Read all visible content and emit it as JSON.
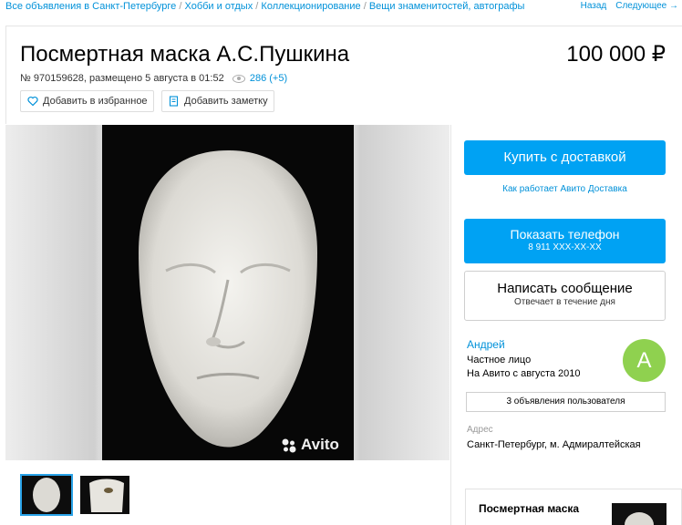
{
  "breadcrumbs": {
    "items": [
      "Все объявления в Санкт-Петербурге",
      "Хобби и отдых",
      "Коллекционирование",
      "Вещи знаменитостей, автографы"
    ],
    "separator": "/"
  },
  "nav": {
    "back": "Назад",
    "next": "Следующее →"
  },
  "listing": {
    "title": "Посмертная маска А.С.Пушкина",
    "price": "100 000 ₽",
    "meta": "№ 970159628, размещено 5 августа в 01:52",
    "views": "286 (+5)"
  },
  "actions": {
    "favorite_label": "Добавить в избранное",
    "note_label": "Добавить заметку"
  },
  "gallery": {
    "watermark": "Avito",
    "thumbnail_count": 2
  },
  "sidebar": {
    "buy_label": "Купить с доставкой",
    "delivery_link": "Как работает Авито Доставка",
    "phone_label": "Показать телефон",
    "phone_number": "8 911 XXX-XX-XX",
    "message_label": "Написать сообщение",
    "message_sub": "Отвечает в течение дня",
    "seller": {
      "name": "Андрей",
      "type": "Частное лицо",
      "since": "На Авито с августа 2010",
      "avatar_letter": "А",
      "ads_count_label": "3 объявления пользователя"
    },
    "address_label": "Адрес",
    "address_value": "Санкт-Петербург, м. Адмиралтейская",
    "related_title": "Посмертная маска"
  },
  "colors": {
    "accent": "#00a2f3",
    "link": "#0091d9",
    "avatar": "#8fd14f"
  }
}
